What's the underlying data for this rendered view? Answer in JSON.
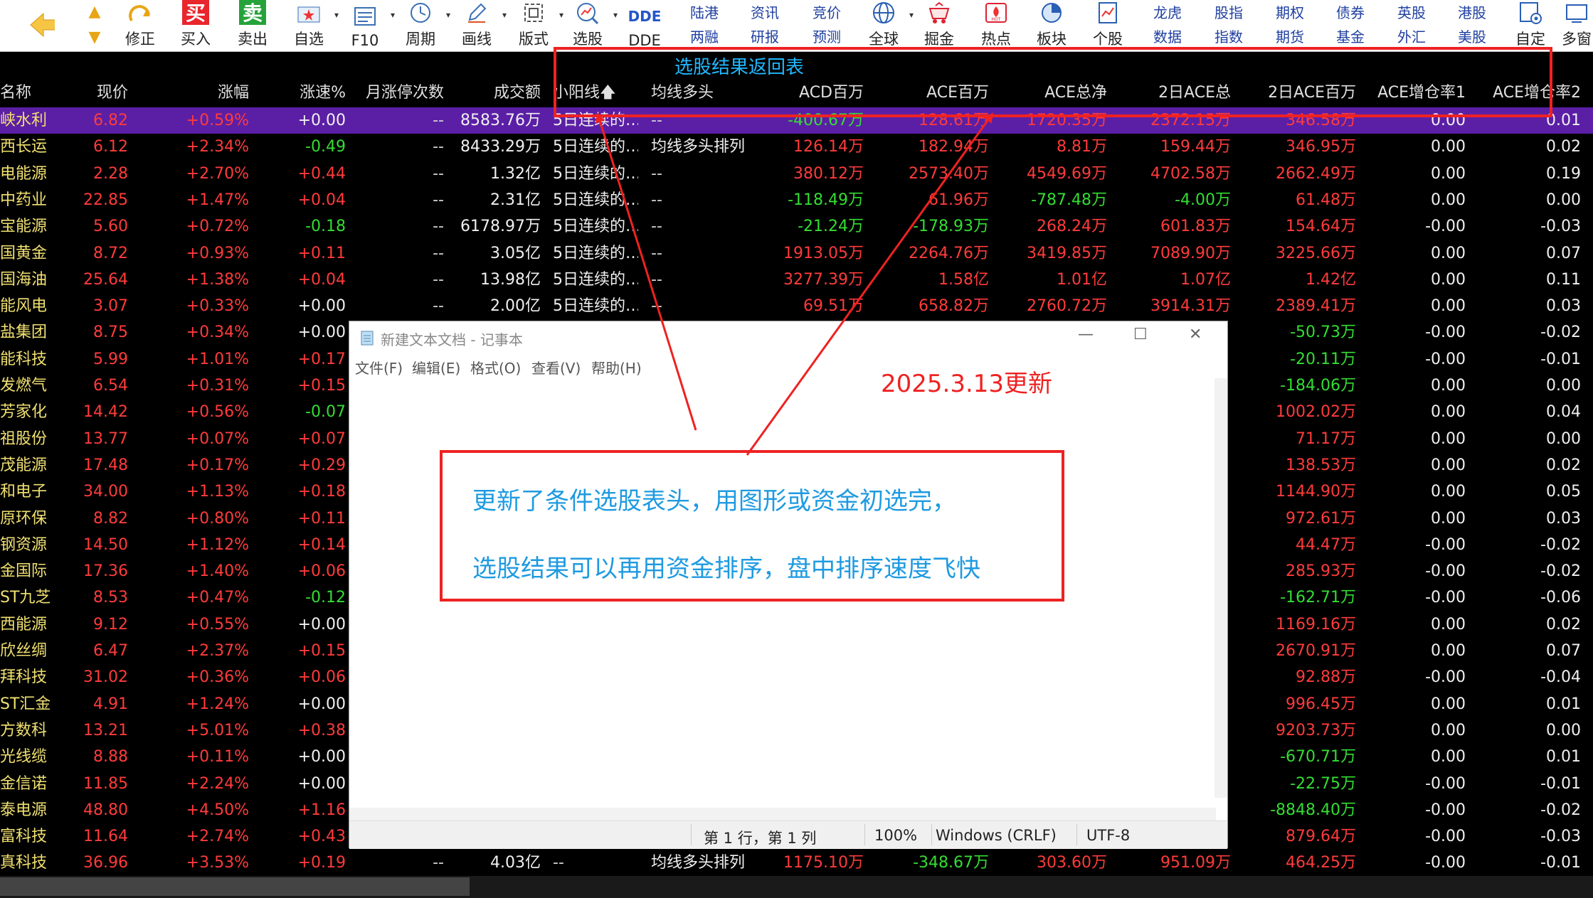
{
  "toolbar": {
    "buttons": [
      {
        "label": "",
        "icon": "back-arrow-icon"
      },
      {
        "label": "修正",
        "icon": "repair-icon"
      },
      {
        "label": "买入",
        "icon": "buy-icon",
        "glyph": "买"
      },
      {
        "label": "卖出",
        "icon": "sell-icon",
        "glyph": "卖"
      },
      {
        "label": "自选",
        "icon": "folder-star-icon"
      },
      {
        "label": "F10",
        "icon": "f10-icon"
      },
      {
        "label": "周期",
        "icon": "clock-icon"
      },
      {
        "label": "画线",
        "icon": "pencil-icon"
      },
      {
        "label": "版式",
        "icon": "layout-icon"
      },
      {
        "label": "选股",
        "icon": "stock-pick-icon"
      },
      {
        "label": "DDE",
        "icon": "dde-icon",
        "glyph": "DDE"
      },
      {
        "label": "全球",
        "icon": "globe-icon"
      },
      {
        "label": "掘金",
        "icon": "mine-cart-icon"
      },
      {
        "label": "热点",
        "icon": "hot-icon"
      },
      {
        "label": "板块",
        "icon": "pie-icon"
      },
      {
        "label": "个股",
        "icon": "stock-doc-icon"
      },
      {
        "label": "自定",
        "icon": "custom-icon"
      },
      {
        "label": "多窗",
        "icon": "multi-window-icon"
      }
    ],
    "links_top": [
      "陆港",
      "资讯",
      "竞价",
      "龙虎",
      "股指",
      "期权",
      "债券",
      "英股",
      "港股"
    ],
    "links_bottom": [
      "两融",
      "研报",
      "预测",
      "数据",
      "指数",
      "期货",
      "基金",
      "外汇",
      "美股"
    ],
    "nav_up": "▲",
    "nav_down": "▼"
  },
  "columns": [
    "名称",
    "现价",
    "涨幅",
    "涨速%",
    "月涨停次数",
    "成交额",
    "小阳线",
    "均线多头",
    "ACD百万",
    "ACE百万",
    "ACE总净",
    "2日ACE总",
    "2日ACE百万",
    "ACE增仓率1",
    "ACE增仓率2"
  ],
  "sort_indicator": "🡅",
  "rows": [
    [
      "峡水利",
      "6.82",
      "+0.59%",
      "+0.00",
      "--",
      "8583.76万",
      "5日连续的…",
      "--",
      "-400.67万",
      "128.61万",
      "1720.35万",
      "2372.15万",
      "346.58万",
      "0.00",
      "0.01"
    ],
    [
      "西长运",
      "6.12",
      "+2.34%",
      "-0.49",
      "--",
      "8433.29万",
      "5日连续的…",
      "均线多头排列",
      "126.14万",
      "182.94万",
      "8.81万",
      "159.44万",
      "346.95万",
      "0.00",
      "0.02"
    ],
    [
      "电能源",
      "2.28",
      "+2.70%",
      "+0.44",
      "--",
      "1.32亿",
      "5日连续的…",
      "--",
      "380.12万",
      "2573.40万",
      "4549.69万",
      "4702.58万",
      "2662.49万",
      "0.00",
      "0.19"
    ],
    [
      "中药业",
      "22.85",
      "+1.47%",
      "+0.04",
      "--",
      "2.31亿",
      "5日连续的…",
      "--",
      "-118.49万",
      "61.96万",
      "-787.48万",
      "-4.00万",
      "61.48万",
      "0.00",
      "0.00"
    ],
    [
      "宝能源",
      "5.60",
      "+0.72%",
      "-0.18",
      "--",
      "6178.97万",
      "5日连续的…",
      "--",
      "-21.24万",
      "-178.93万",
      "268.24万",
      "601.83万",
      "154.64万",
      "-0.00",
      "-0.03"
    ],
    [
      "国黄金",
      "8.72",
      "+0.93%",
      "+0.11",
      "--",
      "3.05亿",
      "5日连续的…",
      "--",
      "1913.05万",
      "2264.76万",
      "3419.85万",
      "7089.90万",
      "3225.66万",
      "0.00",
      "0.07"
    ],
    [
      "国海油",
      "25.64",
      "+1.38%",
      "+0.04",
      "--",
      "13.98亿",
      "5日连续的…",
      "--",
      "3277.39万",
      "1.58亿",
      "1.01亿",
      "1.07亿",
      "1.42亿",
      "0.00",
      "0.11"
    ],
    [
      "能风电",
      "3.07",
      "+0.33%",
      "+0.00",
      "--",
      "2.00亿",
      "5日连续的…",
      "--",
      "69.51万",
      "658.82万",
      "2760.72万",
      "3914.31万",
      "2389.41万",
      "0.00",
      "0.03"
    ],
    [
      "盐集团",
      "8.75",
      "+0.34%",
      "+0.00",
      "",
      "",
      "",
      "",
      "",
      "",
      "",
      "",
      "-50.73万",
      "-0.00",
      "-0.02"
    ],
    [
      "能科技",
      "5.99",
      "+1.01%",
      "+0.17",
      "",
      "",
      "",
      "",
      "",
      "",
      "",
      "",
      "-20.11万",
      "-0.00",
      "-0.01"
    ],
    [
      "发燃气",
      "6.54",
      "+0.31%",
      "+0.15",
      "",
      "",
      "",
      "",
      "",
      "",
      "",
      "",
      "-184.06万",
      "0.00",
      "0.00"
    ],
    [
      "芳家化",
      "14.42",
      "+0.56%",
      "-0.07",
      "",
      "",
      "",
      "",
      "",
      "",
      "",
      "",
      "1002.02万",
      "0.00",
      "0.04"
    ],
    [
      "祖股份",
      "13.77",
      "+0.07%",
      "+0.07",
      "",
      "",
      "",
      "",
      "",
      "",
      "",
      "",
      "71.17万",
      "0.00",
      "0.00"
    ],
    [
      "茂能源",
      "17.48",
      "+0.17%",
      "+0.29",
      "",
      "",
      "",
      "",
      "",
      "",
      "",
      "",
      "138.53万",
      "0.00",
      "0.02"
    ],
    [
      "和电子",
      "34.00",
      "+1.13%",
      "+0.18",
      "",
      "",
      "",
      "",
      "",
      "",
      "",
      "",
      "1144.90万",
      "0.00",
      "0.05"
    ],
    [
      "原环保",
      "8.82",
      "+0.80%",
      "+0.11",
      "",
      "",
      "",
      "",
      "",
      "",
      "",
      "",
      "972.61万",
      "0.00",
      "0.03"
    ],
    [
      "钢资源",
      "14.50",
      "+1.12%",
      "+0.14",
      "",
      "",
      "",
      "",
      "",
      "",
      "",
      "",
      "44.47万",
      "-0.00",
      "-0.02"
    ],
    [
      "金国际",
      "17.36",
      "+1.40%",
      "+0.06",
      "",
      "",
      "",
      "",
      "",
      "",
      "",
      "",
      "285.93万",
      "-0.00",
      "-0.02"
    ],
    [
      "ST九芝",
      "8.53",
      "+0.47%",
      "-0.12",
      "",
      "",
      "",
      "",
      "",
      "",
      "",
      "",
      "-162.71万",
      "-0.00",
      "-0.06"
    ],
    [
      "西能源",
      "9.12",
      "+0.55%",
      "+0.00",
      "",
      "",
      "",
      "",
      "",
      "",
      "",
      "",
      "1169.16万",
      "0.00",
      "0.02"
    ],
    [
      "欣丝绸",
      "6.47",
      "+2.37%",
      "+0.15",
      "",
      "",
      "",
      "",
      "",
      "",
      "",
      "",
      "2670.91万",
      "0.00",
      "0.07"
    ],
    [
      "拜科技",
      "31.02",
      "+0.36%",
      "+0.06",
      "",
      "",
      "",
      "",
      "",
      "",
      "",
      "",
      "92.88万",
      "-0.00",
      "-0.04"
    ],
    [
      "ST汇金",
      "4.91",
      "+1.24%",
      "+0.00",
      "",
      "",
      "",
      "",
      "",
      "",
      "",
      "",
      "996.45万",
      "0.00",
      "0.01"
    ],
    [
      "方数科",
      "13.21",
      "+5.01%",
      "+0.38",
      "",
      "",
      "",
      "",
      "",
      "",
      "",
      "",
      "9203.73万",
      "0.00",
      "0.00"
    ],
    [
      "光线缆",
      "8.88",
      "+0.11%",
      "+0.00",
      "",
      "",
      "",
      "",
      "",
      "",
      "",
      "",
      "-670.71万",
      "0.00",
      "0.01"
    ],
    [
      "金信诺",
      "11.85",
      "+2.24%",
      "+0.00",
      "",
      "",
      "",
      "",
      "",
      "",
      "",
      "",
      "-22.75万",
      "-0.00",
      "-0.01"
    ],
    [
      "泰电源",
      "48.80",
      "+4.50%",
      "+1.16",
      "",
      "",
      "",
      "",
      "",
      "",
      "",
      "",
      "-8848.40万",
      "-0.00",
      "-0.02"
    ],
    [
      "富科技",
      "11.64",
      "+2.74%",
      "+0.43",
      "",
      "",
      "",
      "",
      "",
      "",
      "",
      "",
      "879.64万",
      "-0.00",
      "-0.03"
    ],
    [
      "真科技",
      "36.96",
      "+3.53%",
      "+0.19",
      "--",
      "4.03亿",
      "--",
      "均线多头排列",
      "1175.10万",
      "-348.67万",
      "303.60万",
      "951.09万",
      "464.25万",
      "-0.00",
      "-0.01"
    ]
  ],
  "annotation": {
    "title": "选股结果返回表",
    "update_note": "2025.3.13更新",
    "note_line1": "更新了条件选股表头，用图形或资金初选完，",
    "note_line2": "选股结果可以再用资金排序，盘中排序速度飞快"
  },
  "notepad": {
    "title": "新建文本文档 - 记事本",
    "menu": [
      "文件(F)",
      "编辑(E)",
      "格式(O)",
      "查看(V)",
      "帮助(H)"
    ],
    "status": {
      "position": "第 1 行，第 1 列",
      "zoom": "100%",
      "line_ending": "Windows (CRLF)",
      "encoding": "UTF-8"
    },
    "win_min": "—",
    "win_max": "☐",
    "win_close": "✕"
  },
  "colors": {
    "selected_row": "#5b1fa6",
    "up": "#ff3b3b",
    "down": "#33dd33",
    "annotation_red": "#ee2222",
    "annotation_blue": "#1e9ae0"
  }
}
